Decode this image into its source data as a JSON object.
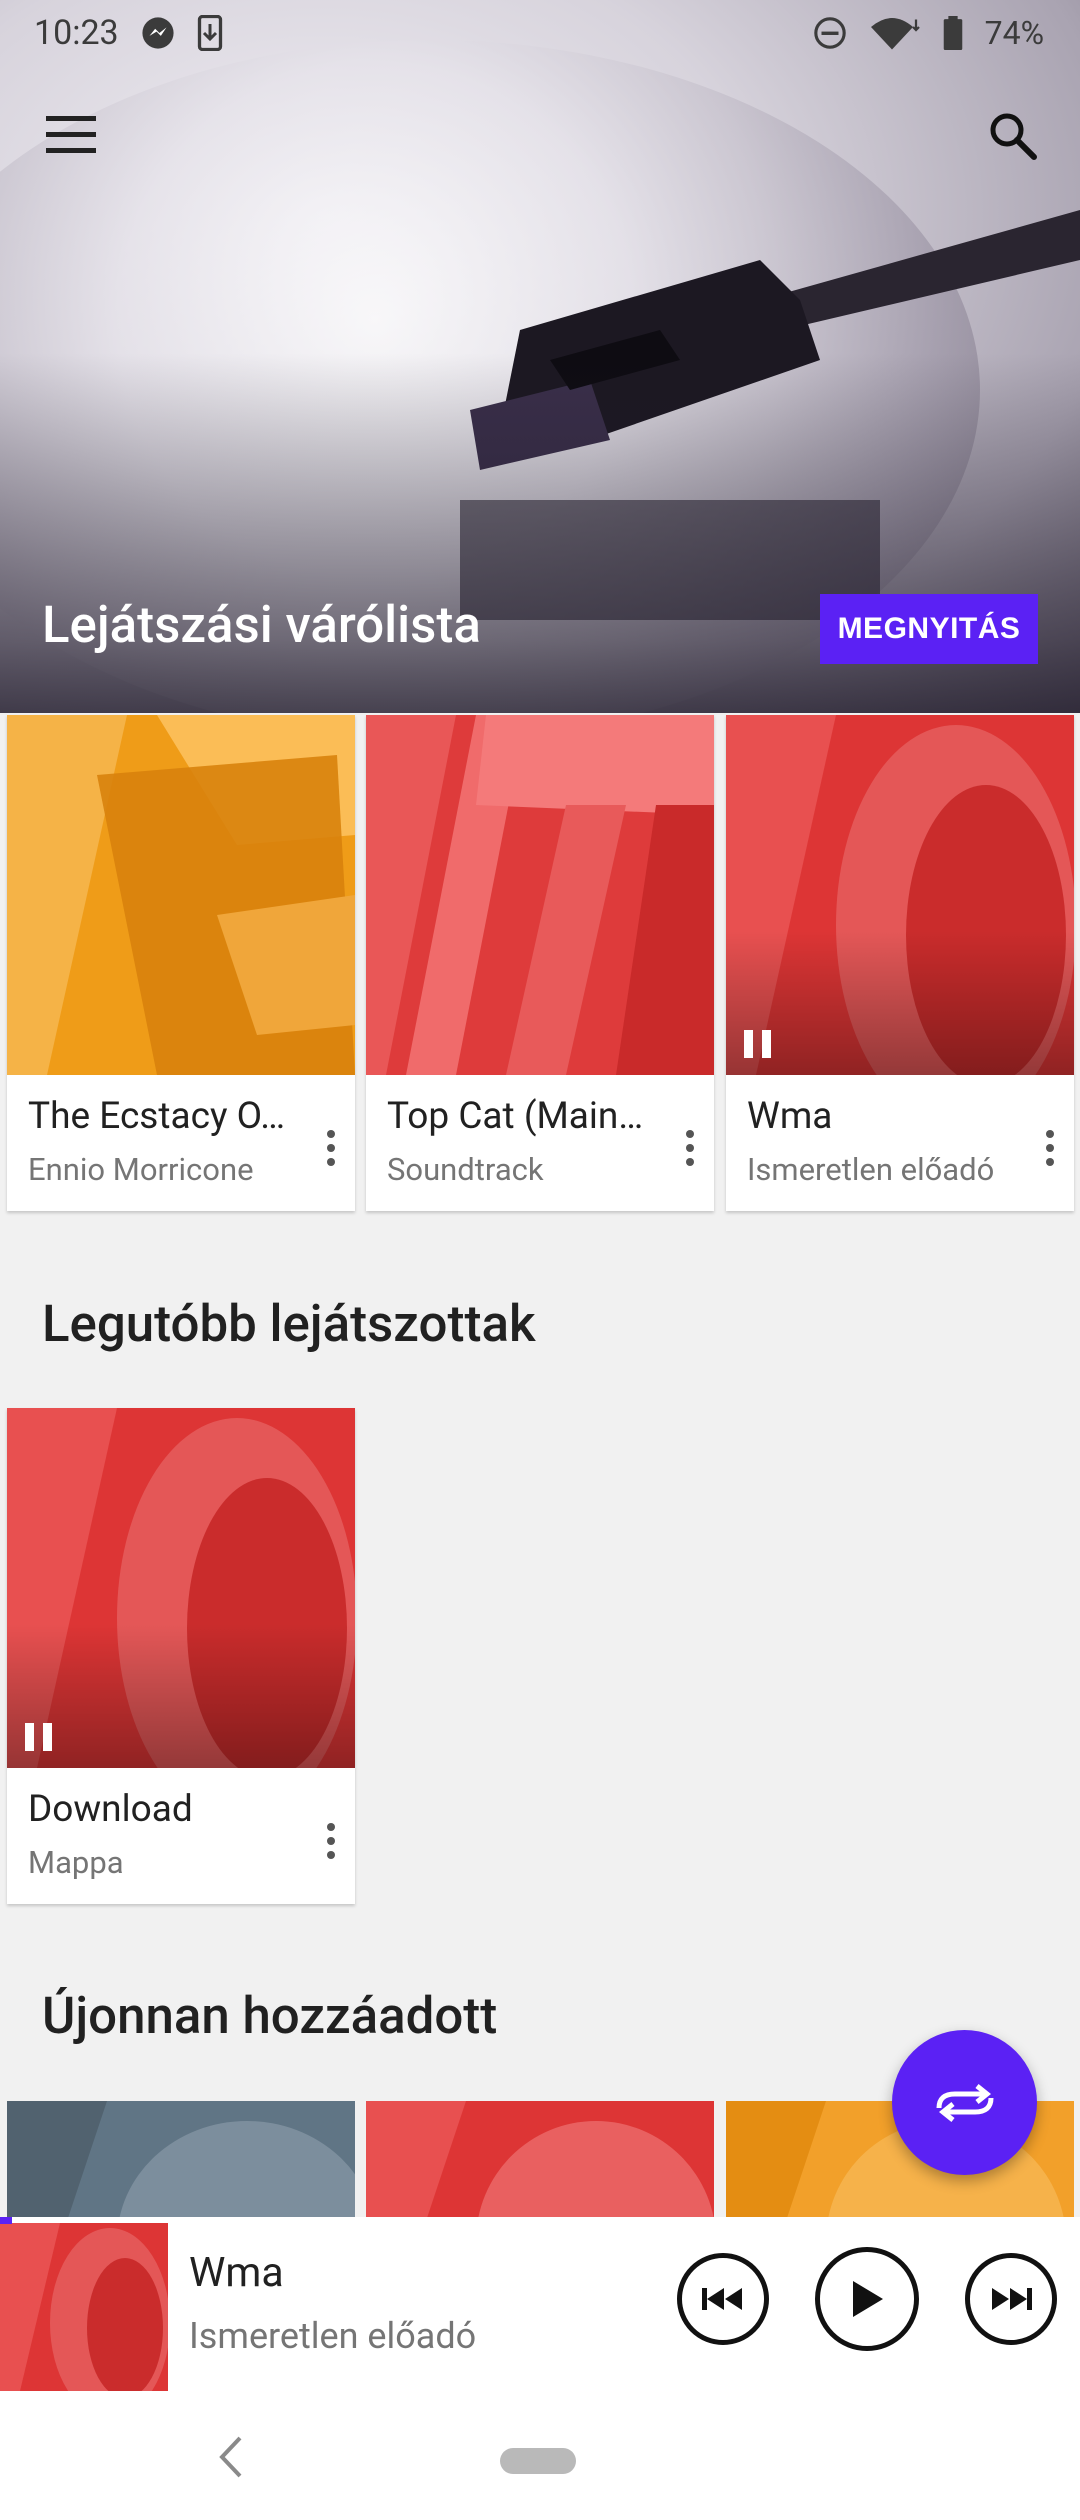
{
  "status_bar": {
    "time": "10:23",
    "battery": "74%"
  },
  "hero": {
    "title": "Lejátszási várólista",
    "open_button": "MEGNYITÁS"
  },
  "queue_cards": [
    {
      "title": "The Ecstacy O…",
      "subtitle": "Ennio Morricone",
      "art_color": "#f4a326",
      "letter": "G"
    },
    {
      "title": "Top Cat (Main…",
      "subtitle": "Soundtrack",
      "art_color": "#e24444",
      "letter": "T"
    },
    {
      "title": "Wma",
      "subtitle": "Ismeretlen előadó",
      "art_color": "#e24444",
      "letter": "D"
    }
  ],
  "recent": {
    "section_title": "Legutóbb lejátszottak",
    "card": {
      "title": "Download",
      "subtitle": "Mappa"
    }
  },
  "new_added": {
    "section_title": "Újonnan hozzáadott"
  },
  "player": {
    "song": "Wma",
    "artist": "Ismeretlen előadó"
  },
  "colors": {
    "accent": "#5b21f4",
    "orange": "#f4a326",
    "red": "#e24444",
    "slate": "#607585"
  },
  "icons": [
    "menu-icon",
    "search-icon",
    "more-vert-icon",
    "pause-icon",
    "shuffle-icon",
    "skip-previous-icon",
    "play-icon",
    "skip-next-icon",
    "back-icon",
    "messenger-icon",
    "download-status-icon",
    "dnd-icon",
    "wifi-icon",
    "battery-icon"
  ]
}
